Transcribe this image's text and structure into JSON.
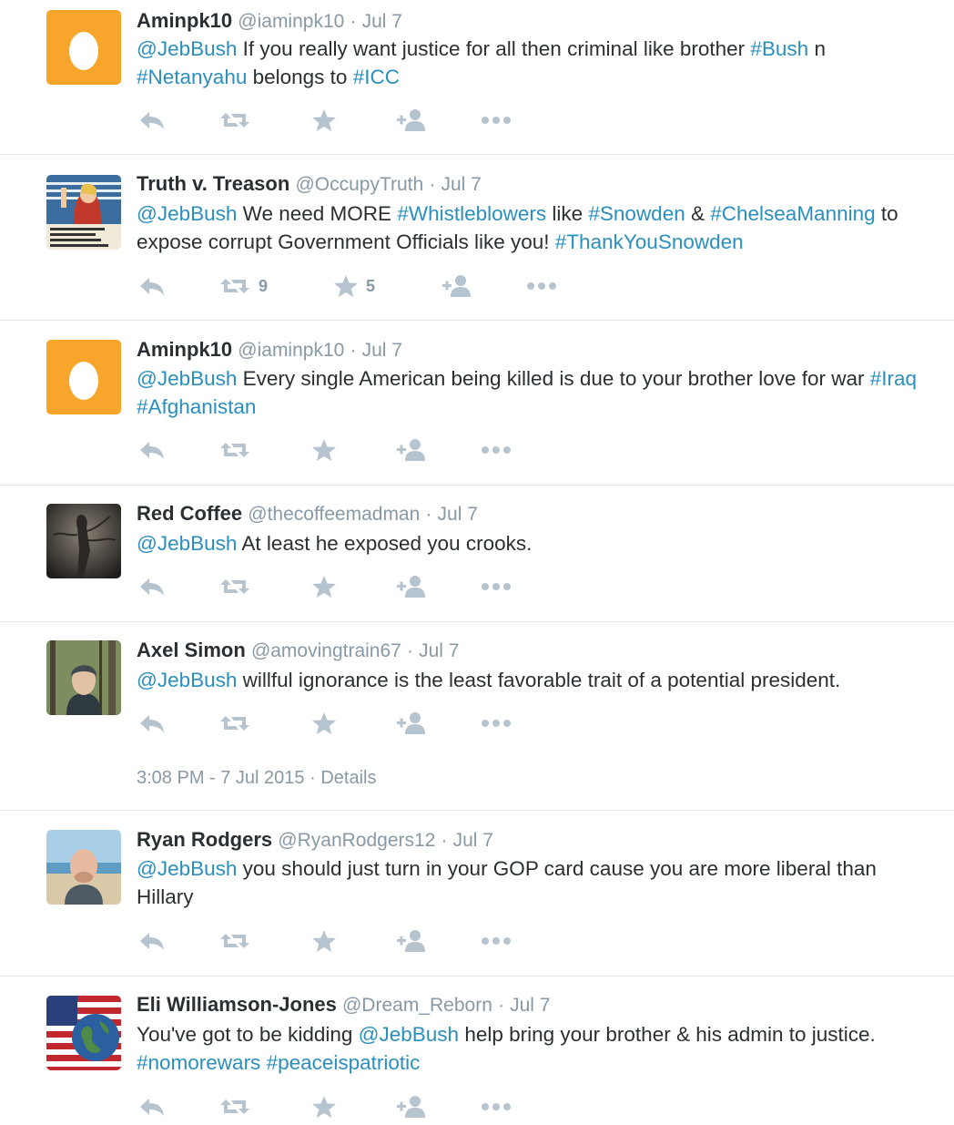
{
  "colors": {
    "link": "#2a8fbd",
    "muted": "#8899a6",
    "icon": "#b6c4cf",
    "egg_bg": "#f8a52b"
  },
  "tweets": [
    {
      "name": "Aminpk10",
      "handle": "@iaminpk10",
      "time": "Jul 7",
      "segments": [
        {
          "text": "@JebBush",
          "link": true
        },
        {
          "text": " If you really want justice for all then criminal like brother "
        },
        {
          "text": "#Bush",
          "link": true
        },
        {
          "text": " n "
        },
        {
          "text": "#Netanyahu",
          "link": true
        },
        {
          "text": " belongs to "
        },
        {
          "text": "#ICC",
          "link": true
        }
      ],
      "retweets": "",
      "favorites": "",
      "avatar": "egg"
    },
    {
      "name": "Truth v. Treason",
      "handle": "@OccupyTruth",
      "time": "Jul 7",
      "segments": [
        {
          "text": "@JebBush",
          "link": true
        },
        {
          "text": " We need MORE "
        },
        {
          "text": "#Whistleblowers",
          "link": true
        },
        {
          "text": " like "
        },
        {
          "text": "#Snowden",
          "link": true
        },
        {
          "text": " & "
        },
        {
          "text": "#ChelseaManning",
          "link": true
        },
        {
          "text": " to expose corrupt Government Officials like you! "
        },
        {
          "text": "#ThankYouSnowden",
          "link": true
        }
      ],
      "retweets": "9",
      "favorites": "5",
      "avatar": "poster"
    },
    {
      "name": "Aminpk10",
      "handle": "@iaminpk10",
      "time": "Jul 7",
      "segments": [
        {
          "text": "@JebBush",
          "link": true
        },
        {
          "text": "  Every single American being killed is due to your brother love for war "
        },
        {
          "text": "#Iraq",
          "link": true
        },
        {
          "text": " "
        },
        {
          "text": "#Afghanistan",
          "link": true
        }
      ],
      "retweets": "",
      "favorites": "",
      "avatar": "egg"
    },
    {
      "name": "Red Coffee",
      "handle": "@thecoffeemadman",
      "time": "Jul 7",
      "segments": [
        {
          "text": "@JebBush",
          "link": true
        },
        {
          "text": " At least he exposed you crooks."
        }
      ],
      "retweets": "",
      "favorites": "",
      "avatar": "dark"
    },
    {
      "name": "Axel Simon",
      "handle": "@amovingtrain67",
      "time": "Jul 7",
      "segments": [
        {
          "text": "@JebBush",
          "link": true
        },
        {
          "text": " willful ignorance is the least favorable trait of a potential president."
        }
      ],
      "retweets": "",
      "favorites": "",
      "avatar": "forest",
      "detail_time": "3:08 PM - 7 Jul 2015",
      "detail_link": "Details"
    },
    {
      "name": "Ryan Rodgers",
      "handle": "@RyanRodgers12",
      "time": "Jul 7",
      "segments": [
        {
          "text": "@JebBush",
          "link": true
        },
        {
          "text": " you should just turn in your GOP card cause you are more liberal than Hillary"
        }
      ],
      "retweets": "",
      "favorites": "",
      "avatar": "beach"
    },
    {
      "name": "Eli Williamson-Jones",
      "handle": "@Dream_Reborn",
      "time": "Jul 7",
      "segments": [
        {
          "text": "You've got to be kidding "
        },
        {
          "text": "@JebBush",
          "link": true
        },
        {
          "text": " help bring your brother & his admin to justice. "
        },
        {
          "text": "#nomorewars",
          "link": true
        },
        {
          "text": " "
        },
        {
          "text": "#peaceispatriotic",
          "link": true
        }
      ],
      "retweets": "",
      "favorites": "",
      "avatar": "flag"
    }
  ]
}
